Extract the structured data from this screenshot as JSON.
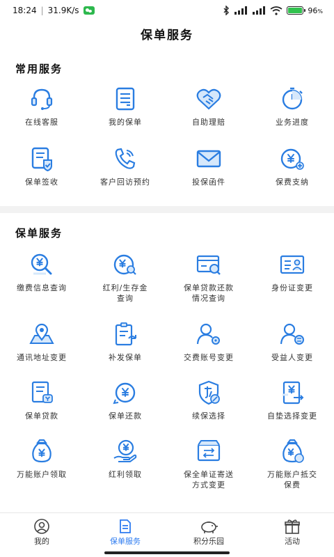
{
  "status_bar": {
    "time": "18:24",
    "speed": "31.9K/s",
    "battery": "96",
    "battery_unit": "%",
    "battery_level": 0.96
  },
  "header": {
    "title": "保单服务"
  },
  "sections": [
    {
      "title": "常用服务",
      "items": [
        {
          "label": "在线客服",
          "icon": "headset-icon"
        },
        {
          "label": "我的保单",
          "icon": "policy-document-icon"
        },
        {
          "label": "自助理赔",
          "icon": "handshake-heart-icon"
        },
        {
          "label": "业务进度",
          "icon": "timer-icon"
        },
        {
          "label": "保单签收",
          "icon": "signed-policy-icon"
        },
        {
          "label": "客户回访预约",
          "icon": "phone-call-icon"
        },
        {
          "label": "投保函件",
          "icon": "envelope-icon"
        },
        {
          "label": "保费支纳",
          "icon": "yen-plus-icon"
        }
      ]
    },
    {
      "title": "保单服务",
      "items": [
        {
          "label": "缴费信息查询",
          "icon": "yen-search-icon"
        },
        {
          "label": "红利/生存金\n查询",
          "icon": "yen-magnifier-icon"
        },
        {
          "label": "保单贷款还款\n情况查询",
          "icon": "card-search-icon"
        },
        {
          "label": "身份证变更",
          "icon": "id-card-icon"
        },
        {
          "label": "通讯地址变更",
          "icon": "map-pin-icon"
        },
        {
          "label": "补发保单",
          "icon": "reissue-document-icon"
        },
        {
          "label": "交费账号变更",
          "icon": "user-gear-icon"
        },
        {
          "label": "受益人变更",
          "icon": "user-swap-icon"
        },
        {
          "label": "保单贷款",
          "icon": "loan-document-icon"
        },
        {
          "label": "保单还款",
          "icon": "yen-return-icon"
        },
        {
          "label": "续保选择",
          "icon": "renewal-shield-icon"
        },
        {
          "label": "自垫选择变更",
          "icon": "yen-switch-icon"
        },
        {
          "label": "万能账户领取",
          "icon": "money-bag-icon"
        },
        {
          "label": "红利领取",
          "icon": "yen-hand-icon"
        },
        {
          "label": "保全单证寄送\n方式变更",
          "icon": "mail-box-icon"
        },
        {
          "label": "万能账户抵交\n保费",
          "icon": "money-bag-offset-icon"
        }
      ]
    }
  ],
  "tab_bar": {
    "tabs": [
      {
        "label": "我的",
        "icon": "profile-icon"
      },
      {
        "label": "保单服务",
        "icon": "policy-tab-icon"
      },
      {
        "label": "积分乐园",
        "icon": "piggy-bank-icon"
      },
      {
        "label": "活动",
        "icon": "gift-icon"
      }
    ]
  },
  "colors": {
    "accent": "#2d7bf0",
    "icon_blue": "#2a7de1"
  }
}
